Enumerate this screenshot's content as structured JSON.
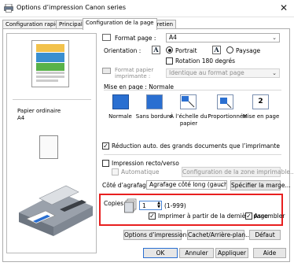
{
  "window": {
    "title": "Options d’impression Canon           series",
    "close": "✕"
  },
  "tabs": [
    "Configuration rapide",
    "Principal",
    "Configuration de la page",
    "Entretien"
  ],
  "preview": {
    "paper_type": "Papier ordinaire",
    "paper_size": "A4"
  },
  "page_size": {
    "label": "Format page :",
    "value": "A4"
  },
  "orientation": {
    "label": "Orientation :",
    "portrait": "Portrait",
    "landscape": "Paysage",
    "rotate": "Rotation 180 degrés"
  },
  "printer_paper": {
    "label": "Format papier imprimante :",
    "value": "Identique au format page"
  },
  "layout": {
    "label": "Mise en page : Normale",
    "options": [
      "Normale",
      "Sans bordure",
      "À l’échelle du papier",
      "Proportionnée",
      "Mise en page"
    ]
  },
  "reduce": "Réduction auto. des grands documents que l’imprimante ne peut pas traiter",
  "duplex": {
    "label": "Impression recto/verso",
    "auto": "Automatique",
    "config_button": "Configuration de la zone imprimable..."
  },
  "staple": {
    "label": "Côté d’agrafage :",
    "value": "Agrafage côté long (gauche)",
    "specify_button": "Spécifier la marge..."
  },
  "copies": {
    "label": "Copies :",
    "value": "1",
    "range": "(1-999)",
    "last_page": "Imprimer à partir de la dernière page",
    "collate": "Assembler"
  },
  "bottom_buttons": {
    "print_options": "Options d’impression...",
    "stamp": "Cachet/Arrière-plan...",
    "defaults": "Défaut"
  },
  "dialog_buttons": {
    "ok": "OK",
    "cancel": "Annuler",
    "apply": "Appliquer",
    "help": "Aide"
  },
  "colors": {
    "accent": "#2a6fd1",
    "highlight": "#e81f1f"
  }
}
